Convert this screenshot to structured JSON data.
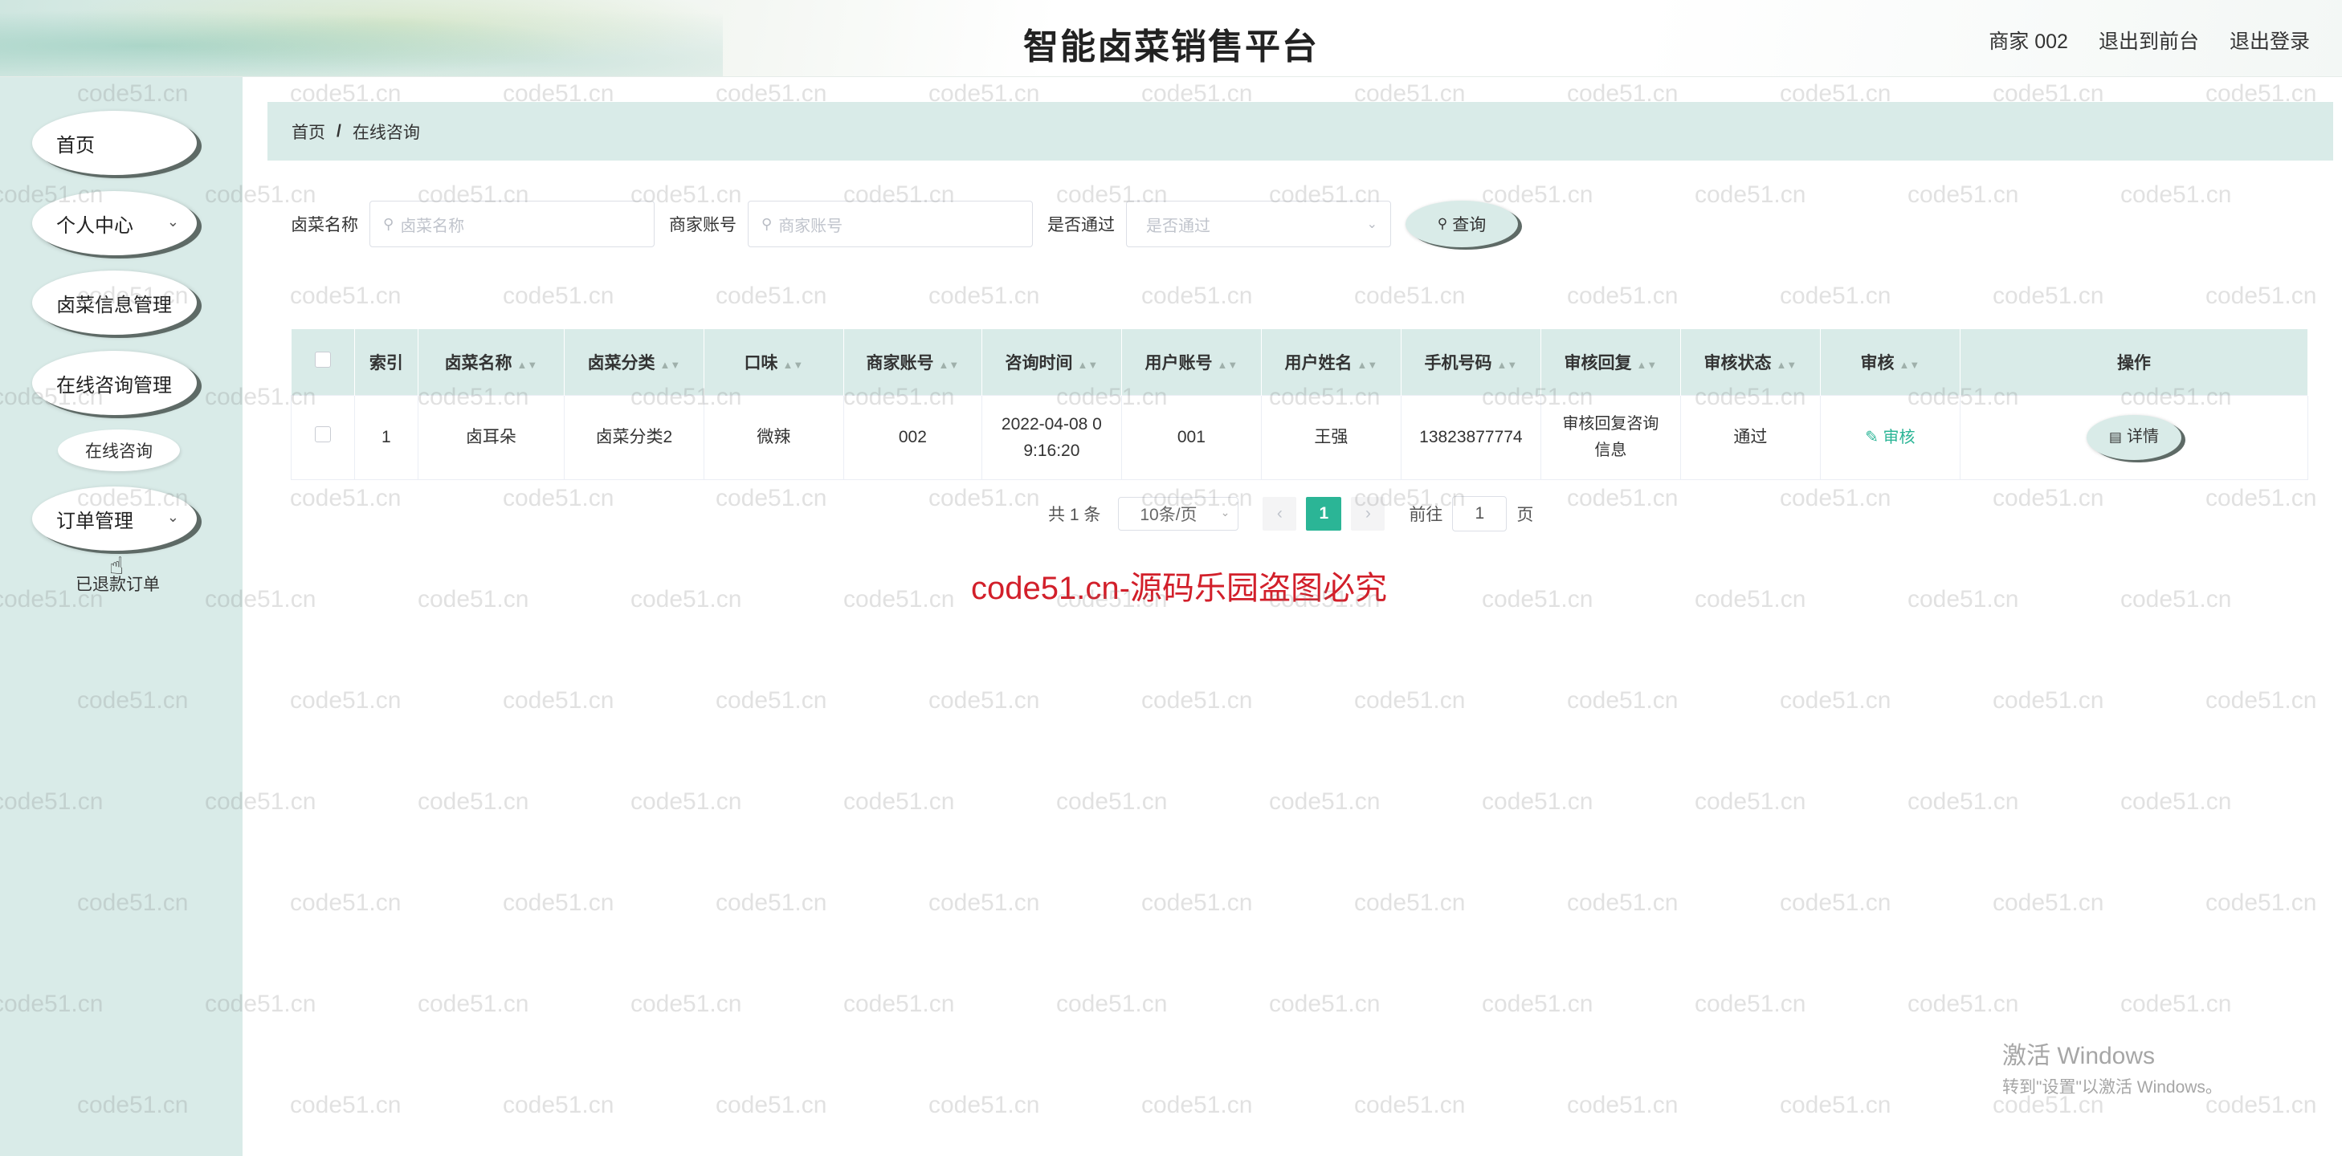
{
  "header": {
    "title": "智能卤菜销售平台",
    "links": [
      "商家 002",
      "退出到前台",
      "退出登录"
    ]
  },
  "sidebar": {
    "items": [
      {
        "label": "首页"
      },
      {
        "label": "个人中心"
      },
      {
        "label": "卤菜信息管理"
      },
      {
        "label": "在线咨询管理"
      },
      {
        "label": "在线咨询"
      },
      {
        "label": "订单管理"
      },
      {
        "label": "已退款订单"
      }
    ]
  },
  "breadcrumb": {
    "home": "首页",
    "sep": "/",
    "current": "在线咨询"
  },
  "search": {
    "name_label": "卤菜名称",
    "name_placeholder": "卤菜名称",
    "merchant_label": "商家账号",
    "merchant_placeholder": "商家账号",
    "pass_label": "是否通过",
    "pass_placeholder": "是否通过",
    "button": "查询"
  },
  "table": {
    "headers": [
      "索引",
      "卤菜名称",
      "卤菜分类",
      "口味",
      "商家账号",
      "咨询时间",
      "用户账号",
      "用户姓名",
      "手机号码",
      "审核回复",
      "审核状态",
      "审核",
      "操作"
    ],
    "rows": [
      {
        "index": "1",
        "name": "卤耳朵",
        "category": "卤菜分类2",
        "flavor": "微辣",
        "merchant": "002",
        "time_l1": "2022-04-08 0",
        "time_l2": "9:16:20",
        "user_account": "001",
        "user_name": "王强",
        "phone": "13823877774",
        "reply_l1": "审核回复咨询",
        "reply_l2": "信息",
        "status": "通过",
        "audit": "审核",
        "action": "详情"
      }
    ]
  },
  "pager": {
    "total": "共 1 条",
    "page_size": "10条/页",
    "current_page": "1",
    "goto_label": "前往",
    "goto_value": "1",
    "page_suffix": "页"
  },
  "notice": "code51.cn-源码乐园盗图必究",
  "watermark": "code51.cn",
  "os_activate": {
    "line1": "激活 Windows",
    "line2": "转到\"设置\"以激活 Windows。"
  },
  "colors": {
    "accent": "#2bb596",
    "panel": "#d9ebe8",
    "notice": "#d21f2a"
  }
}
